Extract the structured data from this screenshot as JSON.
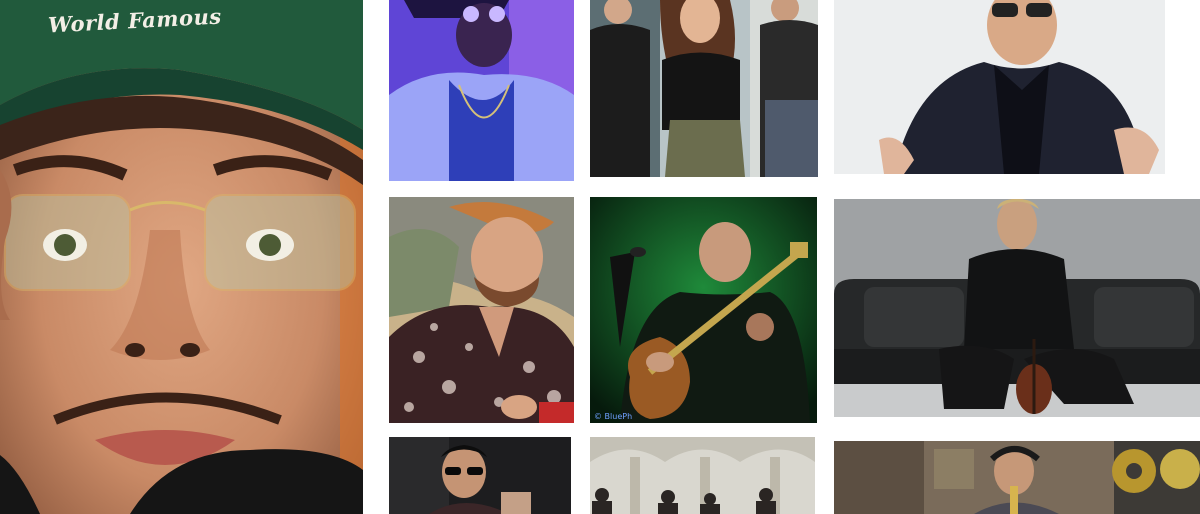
{
  "gallery": {
    "tiles": [
      {
        "name": "photo-man-green-cap",
        "cap_text": "World Famous"
      },
      {
        "name": "photo-man-purple-light"
      },
      {
        "name": "photo-band-trio"
      },
      {
        "name": "photo-man-dark-suit"
      },
      {
        "name": "photo-man-floral-shirt"
      },
      {
        "name": "photo-guitarist-green",
        "credit": "© BluePh"
      },
      {
        "name": "photo-violinist-sofa"
      },
      {
        "name": "photo-man-sunglasses"
      },
      {
        "name": "photo-band-hall"
      },
      {
        "name": "photo-singer-studio"
      }
    ]
  },
  "colors": {
    "background": "#ffffff"
  }
}
